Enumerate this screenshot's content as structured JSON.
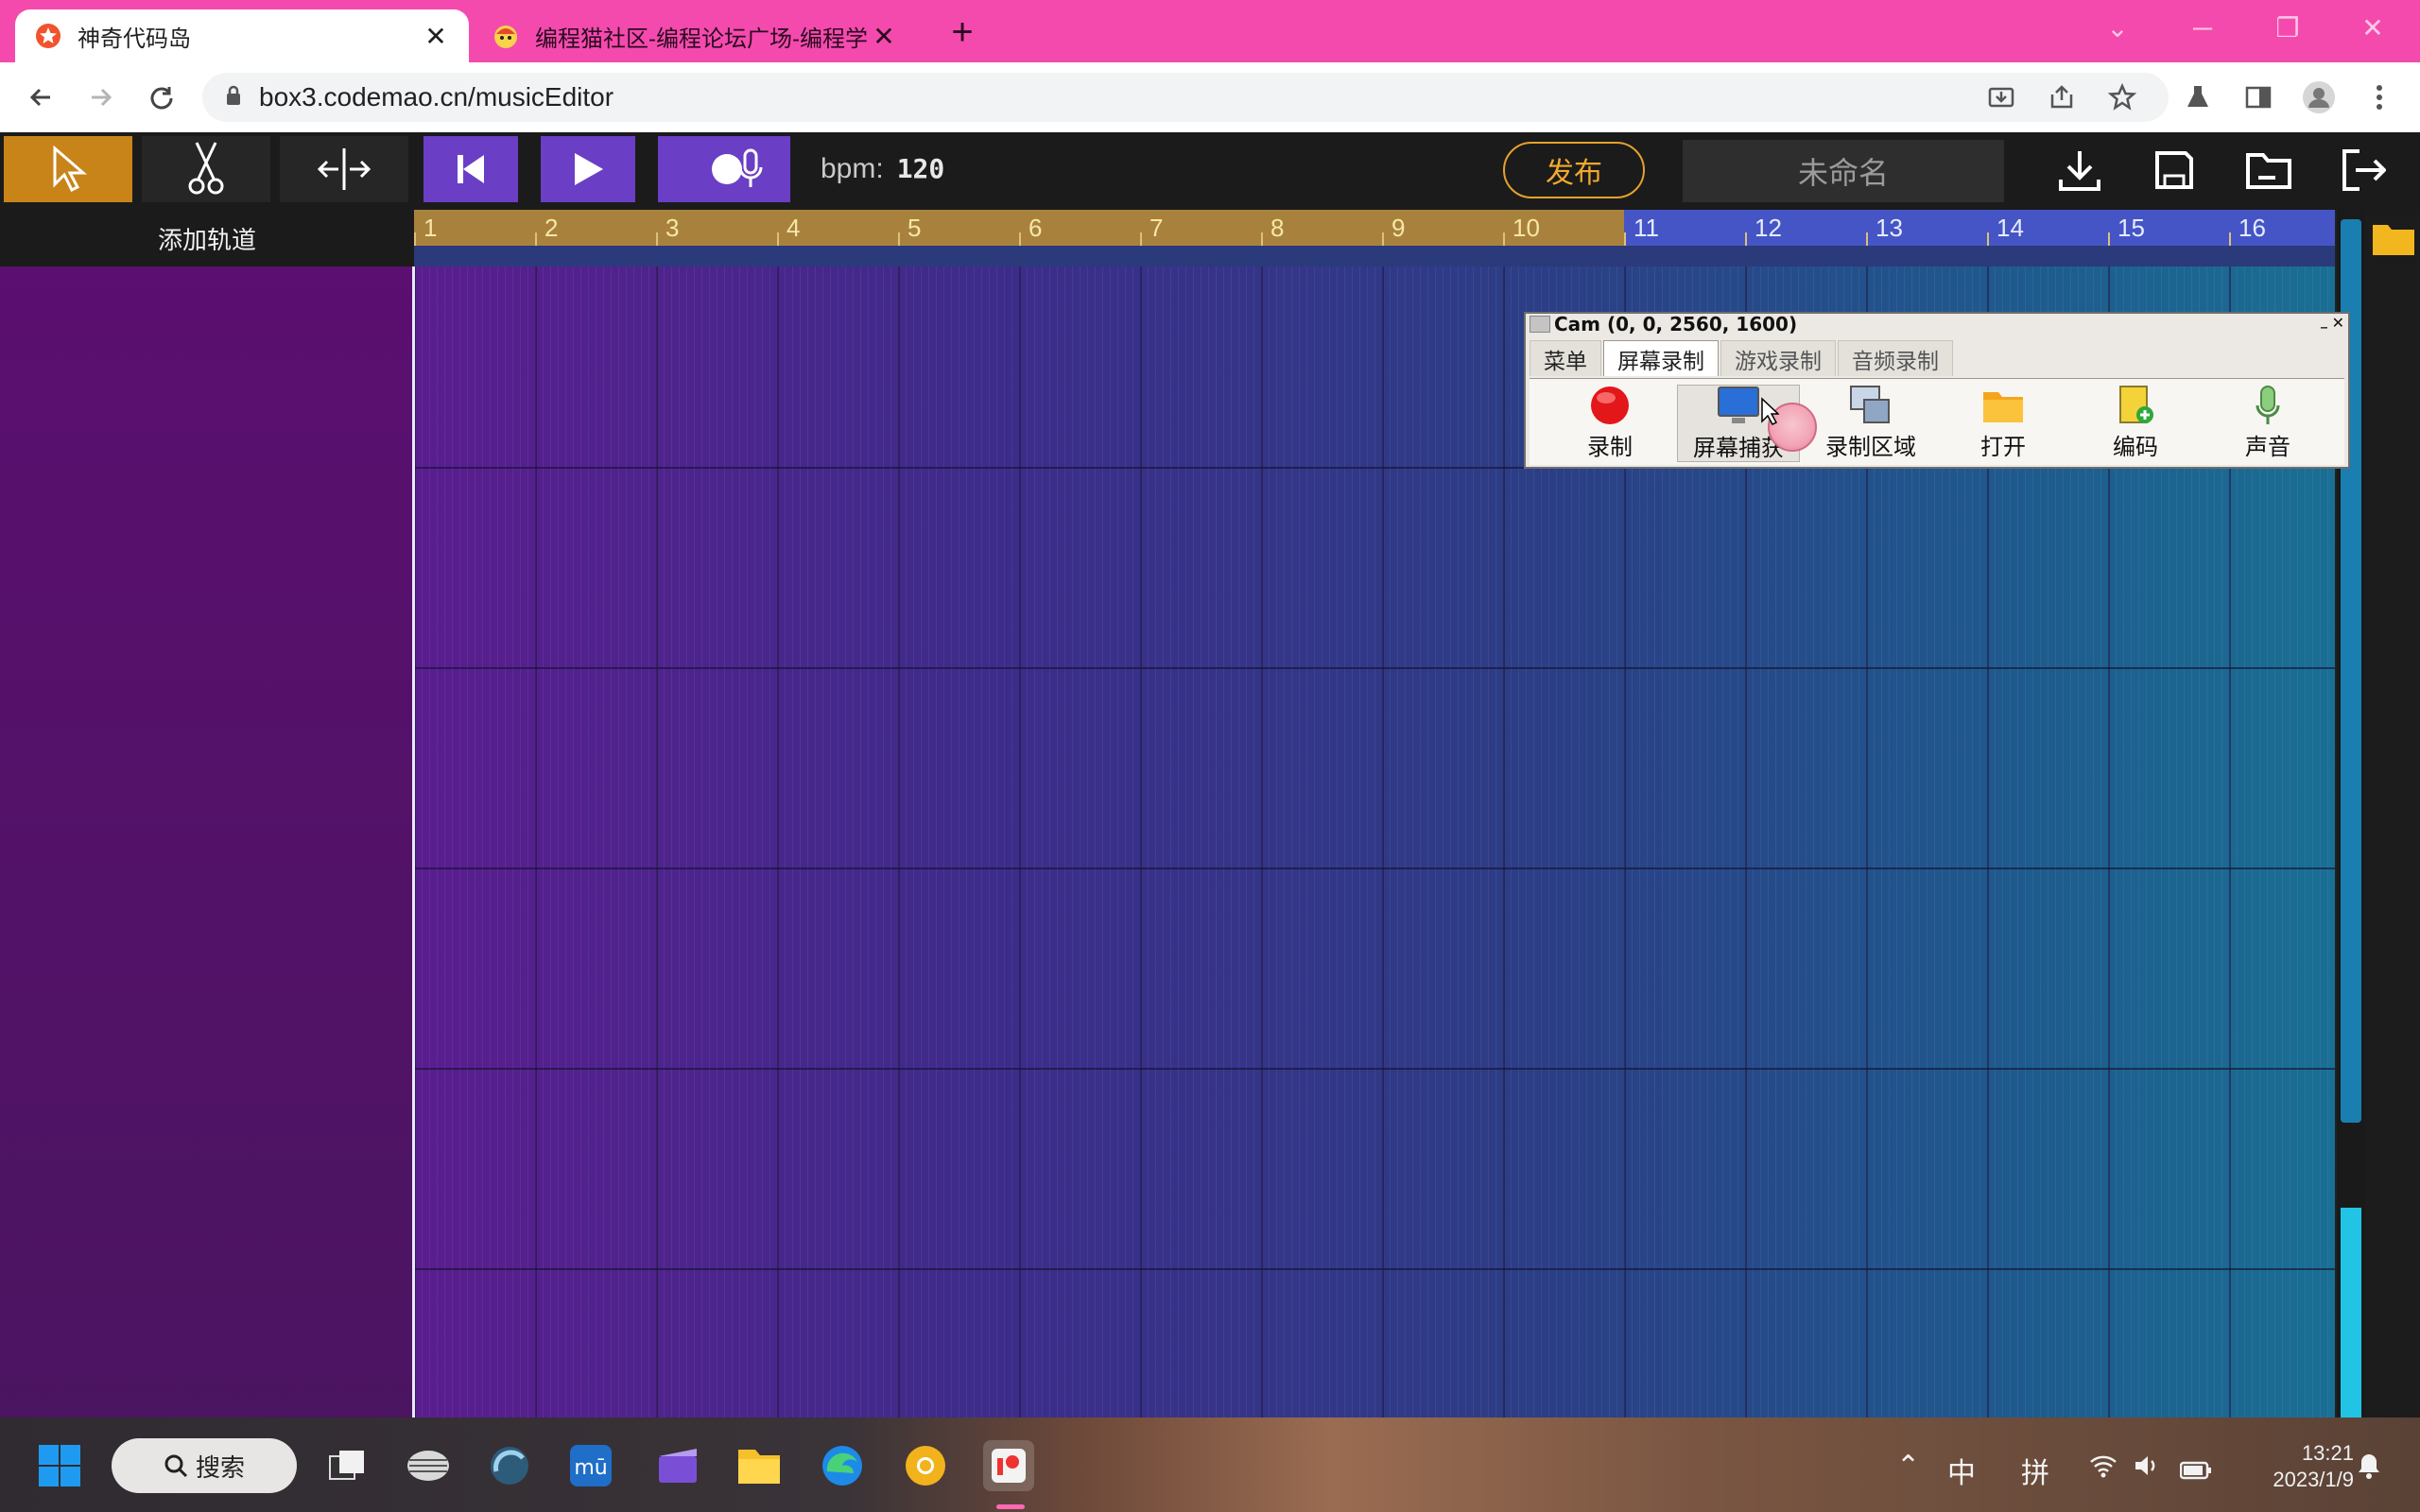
{
  "browser": {
    "tabs": [
      {
        "title": "神奇代码岛",
        "active": true
      },
      {
        "title": "编程猫社区-编程论坛广场-编程学",
        "active": false
      }
    ],
    "address": "box3.codemao.cn/musicEditor",
    "accent": "#f44aae"
  },
  "toolbar": {
    "bpm_label": "bpm:",
    "bpm_value": "120",
    "publish_label": "发布",
    "project_name": "未命名"
  },
  "tracks": {
    "add_track_label": "添加轨道",
    "ruler_numbers": [
      "1",
      "2",
      "3",
      "4",
      "5",
      "6",
      "7",
      "8",
      "9",
      "10",
      "11",
      "12",
      "13",
      "14",
      "15",
      "16"
    ],
    "highlight_from_bar": 11
  },
  "cam": {
    "title": "Cam (0, 0, 2560, 1600)",
    "tabs": [
      "菜单",
      "屏幕录制",
      "游戏录制",
      "音频录制"
    ],
    "selected_tab": "屏幕录制",
    "buttons": [
      "录制",
      "屏幕捕获",
      "录制区域",
      "打开",
      "编码",
      "声音"
    ]
  },
  "taskbar": {
    "search_label": "搜索",
    "ime_lang": "中",
    "ime_mode": "拼",
    "time": "13:21",
    "date": "2023/1/9"
  }
}
